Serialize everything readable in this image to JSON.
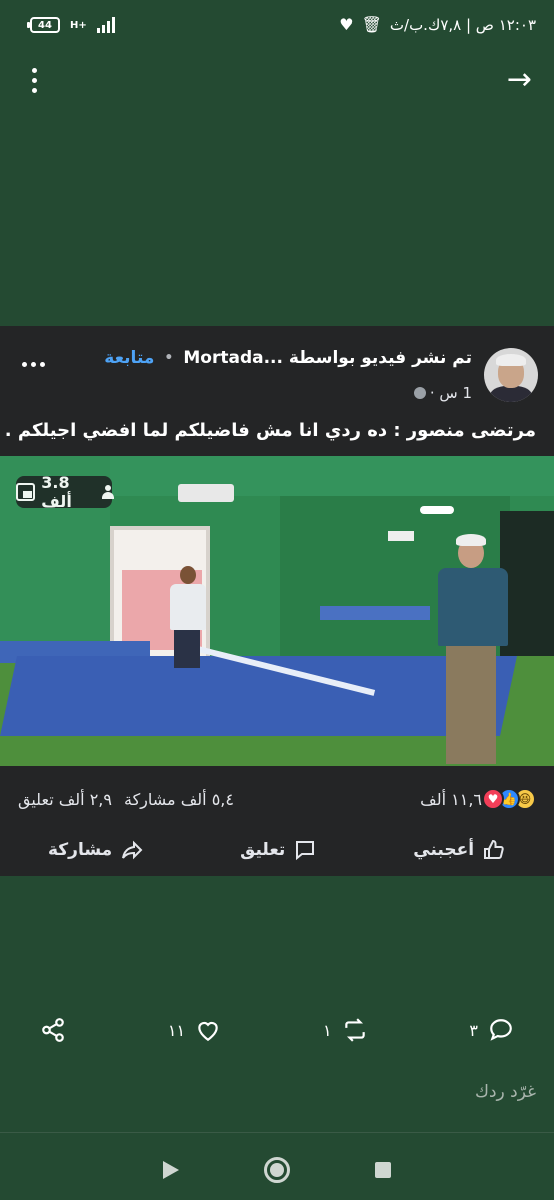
{
  "status_bar": {
    "battery": "44",
    "network": "H+",
    "time_text": "١٢:٠٣ ص | ٧,٨ك.ب/ث"
  },
  "top_bar": {
    "back_icon": "arrow-right-icon",
    "menu_icon": "kebab-menu-icon"
  },
  "post": {
    "author": "Mortada",
    "title_text": "تم نشر فيديو بواسطة ...Mortada",
    "follow_label": "متابعة",
    "time_ago": "1 س ·",
    "caption": "مرتضى منصور : ده ردي انا مش فاضيلكم  لما افضي اجيلكم .",
    "viewers": "3.8 ألف",
    "reactions_count": "١١,٦ ألف",
    "shares_text": "٥,٤ ألف مشاركة",
    "comments_text": "٢,٩ ألف تعليق",
    "actions": {
      "like": "أعجبني",
      "comment": "تعليق",
      "share": "مشاركة"
    }
  },
  "tweet_toolbar": {
    "replies": "٣",
    "retweets": "١",
    "likes": "١١"
  },
  "reply": {
    "placeholder": "غرّد ردك"
  },
  "colors": {
    "background": "#244a32",
    "card": "#242526",
    "link": "#4ea3f6"
  }
}
